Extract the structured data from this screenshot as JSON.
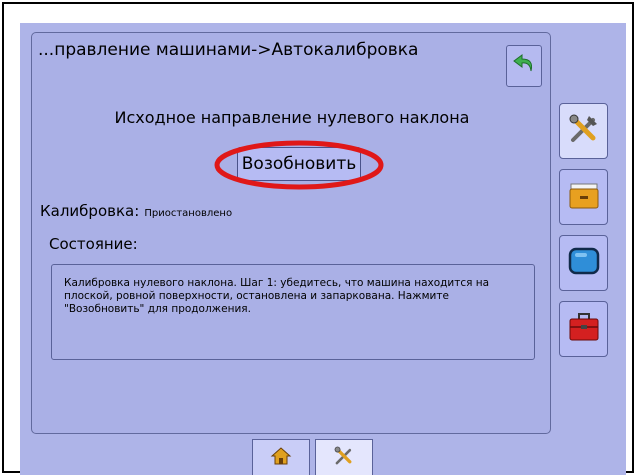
{
  "header": {
    "title": "...правление машинами->Автокалибровка",
    "back_icon": "back-arrow-icon"
  },
  "main": {
    "heading": "Исходное направление нулевого наклона",
    "resume_button": "Возобновить",
    "calibration_label": "Калибровка:",
    "calibration_value": "Приостановлено",
    "status_label": "Состояние:",
    "status_message": "Калибровка нулевого наклона. Шаг 1: убедитесь, что машина находится на плоской, ровной поверхности, остановлена и запаркована. Нажмите \"Возобновить\" для продолжения."
  },
  "side_nav": [
    {
      "icon": "tools-icon",
      "active": true
    },
    {
      "icon": "file-drawer-icon",
      "active": false
    },
    {
      "icon": "monitor-icon",
      "active": false
    },
    {
      "icon": "toolbox-icon",
      "active": false
    }
  ],
  "bottom_tabs": [
    {
      "icon": "home-icon",
      "active": false
    },
    {
      "icon": "tools-icon",
      "active": true
    }
  ],
  "colors": {
    "screen_bg": "#aeb4e8",
    "highlight_ring": "#e01818",
    "toolbox_red": "#d42020",
    "monitor_blue": "#2f8ed8",
    "back_arrow_green": "#3fb050"
  }
}
